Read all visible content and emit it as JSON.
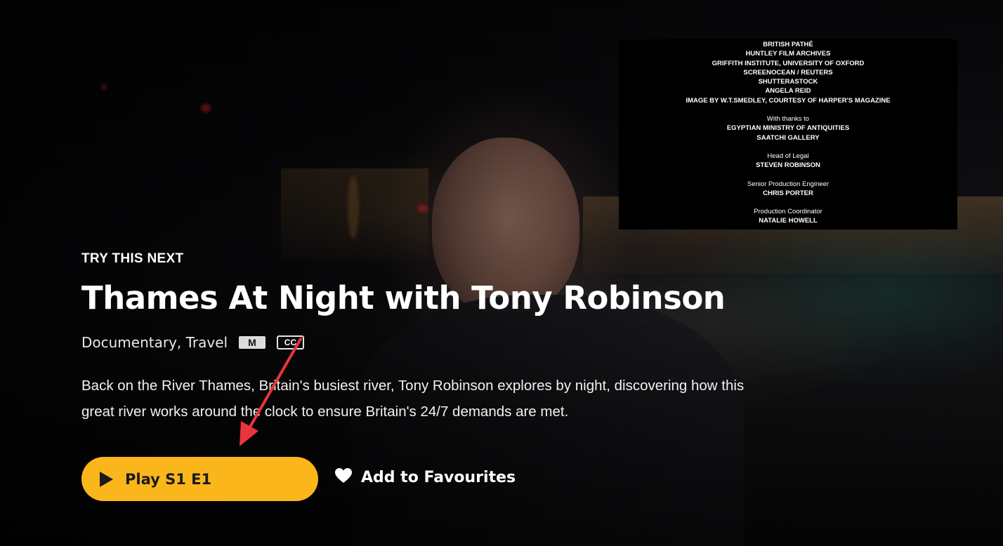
{
  "hero": {
    "eyebrow": "TRY THIS NEXT",
    "title": "Thames At Night with Tony Robinson",
    "genres": "Documentary, Travel",
    "rating": "M",
    "cc_badge": "CC",
    "description": "Back on the River Thames, Britain's busiest river, Tony Robinson explores by night, discovering how this great river works around the clock to ensure Britain's 24/7 demands are met.",
    "play_label": "Play S1 E1",
    "favourite_label": "Add to Favourites",
    "accent_color": "#fbb61c"
  },
  "credits": {
    "group1": [
      "BRITISH PATHÉ",
      "HUNTLEY FILM ARCHIVES",
      "GRIFFITH INSTITUTE, UNIVERSITY OF OXFORD",
      "SCREENOCEAN / REUTERS",
      "SHUTTERASTOCK",
      "ANGELA REID",
      "IMAGE BY W.T.SMEDLEY, COURTESY OF HARPER'S MAGAZINE"
    ],
    "thanks_heading": "With thanks to",
    "thanks": [
      "EGYPTIAN MINISTRY OF ANTIQUITIES",
      "SAATCHI GALLERY"
    ],
    "legal_role": "Head of Legal",
    "legal_name": "STEVEN ROBINSON",
    "engineer_role": "Senior Production Engineer",
    "engineer_name": "CHRIS PORTER",
    "coordinator_role": "Production Coordinator",
    "coordinator_name": "NATALIE HOWELL"
  },
  "icons": {
    "play": "play-icon",
    "favourite": "heart-icon",
    "annotation": "red-arrow-annotation",
    "annotation_color": "#e8353a"
  }
}
